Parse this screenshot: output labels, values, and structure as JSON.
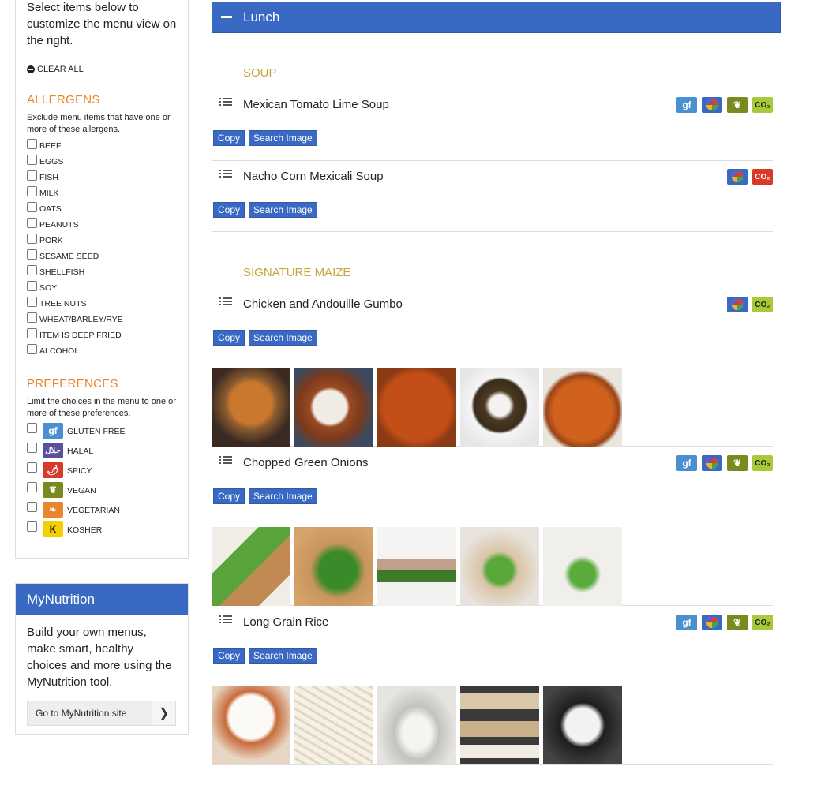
{
  "sidebar": {
    "intro": "Select items below to customize the menu view on the right.",
    "clear_all": "CLEAR ALL",
    "allergens": {
      "title": "ALLERGENS",
      "desc": "Exclude menu items that have one or more of these allergens.",
      "items": [
        "BEEF",
        "EGGS",
        "FISH",
        "MILK",
        "OATS",
        "PEANUTS",
        "PORK",
        "SESAME SEED",
        "SHELLFISH",
        "SOY",
        "TREE NUTS",
        "WHEAT/BARLEY/RYE",
        "ITEM IS DEEP FRIED",
        "ALCOHOL"
      ]
    },
    "preferences": {
      "title": "PREFERENCES",
      "desc": "Limit the choices in the menu to one or more of these preferences.",
      "items": [
        {
          "label": "GLUTEN FREE",
          "icon": "gluten-free-icon",
          "glyph": "gf",
          "color": "#4a8fd0"
        },
        {
          "label": "HALAL",
          "icon": "halal-icon",
          "glyph": "حلال",
          "color": "#5b4f9e"
        },
        {
          "label": "SPICY",
          "icon": "spicy-icon",
          "glyph": "🌶",
          "color": "#d83a2a"
        },
        {
          "label": "VEGAN",
          "icon": "vegan-icon",
          "glyph": "❦",
          "color": "#7a8a1e"
        },
        {
          "label": "VEGETARIAN",
          "icon": "vegetarian-icon",
          "glyph": "❧",
          "color": "#e8862b"
        },
        {
          "label": "KOSHER",
          "icon": "kosher-icon",
          "glyph": "K",
          "color": "#222222"
        }
      ]
    }
  },
  "mynutrition": {
    "title": "MyNutrition",
    "text": "Build your own menus, make smart, healthy choices and more using the MyNutrition tool.",
    "button": "Go to MyNutrition site"
  },
  "menu": {
    "meal": "Lunch",
    "copy_label": "Copy",
    "search_label": "Search Image",
    "categories": [
      {
        "title": "SOUP"
      },
      {
        "title": "SIGNATURE MAIZE"
      }
    ],
    "items": [
      {
        "name": "Mexican Tomato Lime Soup",
        "badges": [
          "gf",
          "balanced",
          "vegan",
          "co2-low"
        ]
      },
      {
        "name": "Nacho Corn Mexicali Soup",
        "badges": [
          "balanced",
          "co2-high"
        ]
      },
      {
        "name": "Chicken and Andouille Gumbo",
        "badges": [
          "balanced",
          "co2-low"
        ]
      },
      {
        "name": "Chopped Green Onions",
        "badges": [
          "gf",
          "balanced",
          "vegan",
          "co2-low"
        ]
      },
      {
        "name": "Long Grain Rice",
        "badges": [
          "gf",
          "balanced",
          "vegan",
          "co2-low"
        ]
      }
    ]
  },
  "colors": {
    "accent": "#3a69c4",
    "orange": "#e8862b",
    "gold": "#c8a43c"
  }
}
